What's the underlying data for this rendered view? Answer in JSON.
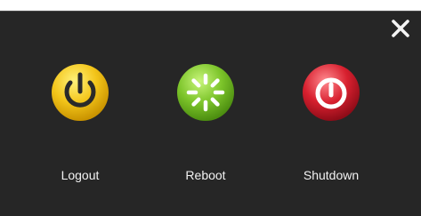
{
  "dialog": {
    "close_icon": "close-icon",
    "options": [
      {
        "label": "Logout",
        "icon": "power-icon",
        "color": "#f2c21b"
      },
      {
        "label": "Reboot",
        "icon": "restart-icon",
        "color": "#7cc42a"
      },
      {
        "label": "Shutdown",
        "icon": "shutdown-icon",
        "color": "#d8202f"
      }
    ]
  }
}
